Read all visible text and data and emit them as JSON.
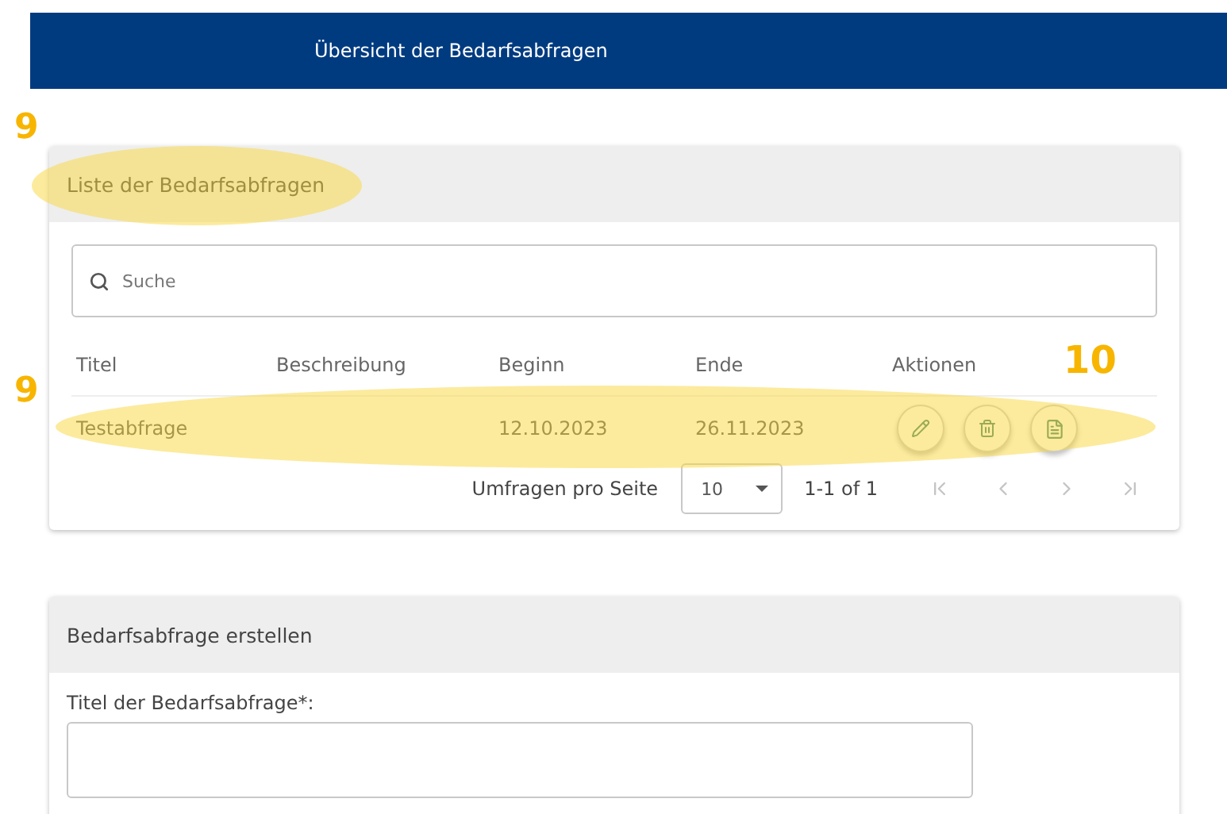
{
  "header": {
    "title": "Übersicht der Bedarfsabfragen"
  },
  "list_card": {
    "title": "Liste der Bedarfsabfragen",
    "search": {
      "placeholder": "Suche"
    },
    "table": {
      "columns": [
        "Titel",
        "Beschreibung",
        "Beginn",
        "Ende",
        "Aktionen"
      ],
      "rows": [
        {
          "cells": [
            "Testabfrage",
            "",
            "12.10.2023",
            "26.11.2023"
          ],
          "actions": [
            {
              "kind": "edit"
            },
            {
              "kind": "delete"
            },
            {
              "kind": "copy"
            }
          ]
        }
      ]
    },
    "pagination": {
      "label": "Umfragen pro Seite",
      "page_size": "10",
      "range": "1-1 of 1",
      "buttons": [
        {
          "kind": "first",
          "disabled": true
        },
        {
          "kind": "prev",
          "disabled": true
        },
        {
          "kind": "next",
          "disabled": true
        },
        {
          "kind": "last",
          "disabled": true
        }
      ]
    }
  },
  "create_card": {
    "title": "Bedarfsabfrage erstellen",
    "field_label": "Titel der Bedarfsabfrage*:"
  },
  "annotations": [
    {
      "kind": "card-title",
      "label": "9"
    },
    {
      "kind": "row",
      "label": "9"
    },
    {
      "kind": "actions",
      "label": "10"
    }
  ]
}
